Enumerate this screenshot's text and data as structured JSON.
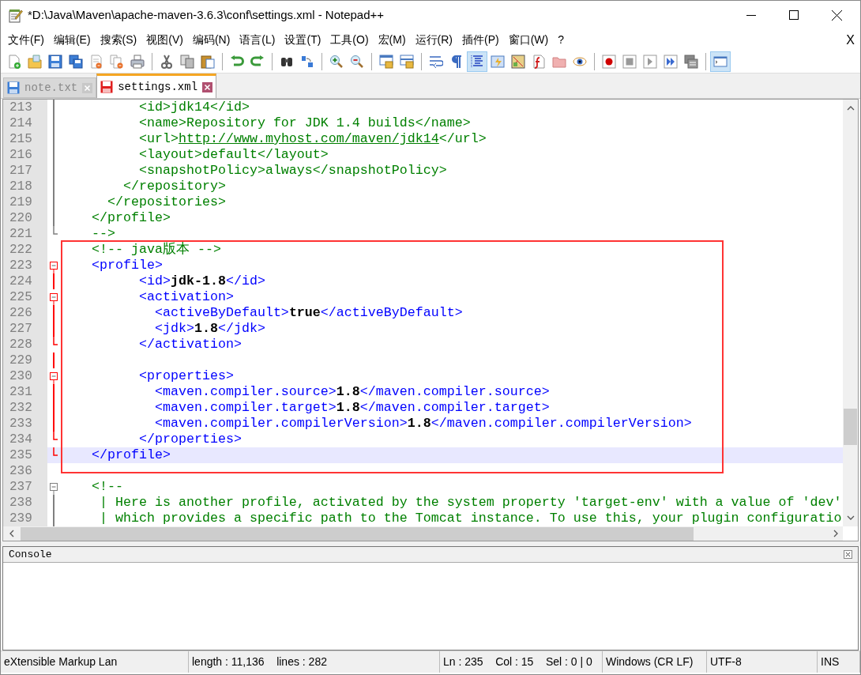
{
  "window": {
    "title": "*D:\\Java\\Maven\\apache-maven-3.6.3\\conf\\settings.xml - Notepad++"
  },
  "menu": [
    "文件(F)",
    "编辑(E)",
    "搜索(S)",
    "视图(V)",
    "编码(N)",
    "语言(L)",
    "设置(T)",
    "工具(O)",
    "宏(M)",
    "运行(R)",
    "插件(P)",
    "窗口(W)",
    "?"
  ],
  "menu_close": "X",
  "toolbar": [
    {
      "kind": "new",
      "pressed": false
    },
    {
      "kind": "open",
      "pressed": false
    },
    {
      "kind": "save",
      "pressed": false
    },
    {
      "kind": "save-all",
      "pressed": false
    },
    {
      "kind": "close",
      "pressed": false
    },
    {
      "kind": "close-all",
      "pressed": false
    },
    {
      "kind": "print",
      "pressed": false
    },
    {
      "kind": "separator"
    },
    {
      "kind": "cut",
      "pressed": false
    },
    {
      "kind": "copy",
      "pressed": false
    },
    {
      "kind": "paste",
      "pressed": false
    },
    {
      "kind": "separator"
    },
    {
      "kind": "undo",
      "pressed": false
    },
    {
      "kind": "redo",
      "pressed": false
    },
    {
      "kind": "separator"
    },
    {
      "kind": "find",
      "pressed": false
    },
    {
      "kind": "replace",
      "pressed": false
    },
    {
      "kind": "separator"
    },
    {
      "kind": "zoom-in",
      "pressed": false
    },
    {
      "kind": "zoom-out",
      "pressed": false
    },
    {
      "kind": "separator"
    },
    {
      "kind": "sync-v",
      "pressed": false
    },
    {
      "kind": "sync-h",
      "pressed": false
    },
    {
      "kind": "separator"
    },
    {
      "kind": "wrap",
      "pressed": false
    },
    {
      "kind": "all-chars",
      "pressed": false
    },
    {
      "kind": "indent-guide",
      "pressed": true
    },
    {
      "kind": "udl",
      "pressed": false
    },
    {
      "kind": "doc-map",
      "pressed": false
    },
    {
      "kind": "func-list",
      "pressed": false
    },
    {
      "kind": "folder",
      "pressed": false
    },
    {
      "kind": "monitor",
      "pressed": false
    },
    {
      "kind": "separator"
    },
    {
      "kind": "record",
      "pressed": false
    },
    {
      "kind": "stop",
      "pressed": false
    },
    {
      "kind": "play",
      "pressed": false
    },
    {
      "kind": "play-multi",
      "pressed": false
    },
    {
      "kind": "save-macro",
      "pressed": false
    },
    {
      "kind": "separator"
    },
    {
      "kind": "console",
      "pressed": true
    }
  ],
  "tabs": [
    {
      "label": "note.txt",
      "selected": false,
      "modified": false
    },
    {
      "label": "settings.xml",
      "selected": true,
      "modified": true
    }
  ],
  "editor": {
    "lines": [
      {
        "number": "213",
        "current": false,
        "fold_marker": {
          "kind": "body",
          "active": false
        },
        "segments": [
          {
            "kind": "comment",
            "text": "          <id>jdk14</id>"
          }
        ]
      },
      {
        "number": "214",
        "current": false,
        "fold_marker": {
          "kind": "body",
          "active": false
        },
        "segments": [
          {
            "kind": "comment",
            "text": "          <name>Repository for JDK 1.4 builds</name>"
          }
        ]
      },
      {
        "number": "215",
        "current": false,
        "fold_marker": {
          "kind": "body",
          "active": false
        },
        "segments": [
          {
            "kind": "comment",
            "text": "          <url>"
          },
          {
            "kind": "link",
            "text": "http://www.myhost.com/maven/jdk14"
          },
          {
            "kind": "comment",
            "text": "</url>"
          }
        ]
      },
      {
        "number": "216",
        "current": false,
        "fold_marker": {
          "kind": "body",
          "active": false
        },
        "segments": [
          {
            "kind": "comment",
            "text": "          <layout>default</layout>"
          }
        ]
      },
      {
        "number": "217",
        "current": false,
        "fold_marker": {
          "kind": "body",
          "active": false
        },
        "segments": [
          {
            "kind": "comment",
            "text": "          <snapshotPolicy>always</snapshotPolicy>"
          }
        ]
      },
      {
        "number": "218",
        "current": false,
        "fold_marker": {
          "kind": "body",
          "active": false
        },
        "segments": [
          {
            "kind": "comment",
            "text": "        </repository>"
          }
        ]
      },
      {
        "number": "219",
        "current": false,
        "fold_marker": {
          "kind": "body",
          "active": false
        },
        "segments": [
          {
            "kind": "comment",
            "text": "      </repositories>"
          }
        ]
      },
      {
        "number": "220",
        "current": false,
        "fold_marker": {
          "kind": "body",
          "active": false
        },
        "segments": [
          {
            "kind": "comment",
            "text": "    </profile>"
          }
        ]
      },
      {
        "number": "221",
        "current": false,
        "fold_marker": {
          "kind": "end",
          "active": false
        },
        "segments": [
          {
            "kind": "comment",
            "text": "    -->"
          }
        ]
      },
      {
        "number": "222",
        "current": false,
        "segments": [
          {
            "kind": "comment",
            "text": "    <!-- java版本 -->"
          }
        ]
      },
      {
        "number": "223",
        "current": false,
        "fold_marker": {
          "kind": "open",
          "active": true
        },
        "segments": [
          {
            "kind": "tag",
            "text": "    <profile>"
          }
        ]
      },
      {
        "number": "224",
        "current": false,
        "fold_marker": {
          "kind": "body",
          "active": true
        },
        "segments": [
          {
            "kind": "tag",
            "text": "          <id>"
          },
          {
            "kind": "value",
            "text": "jdk-1.8"
          },
          {
            "kind": "tag",
            "text": "</id>"
          }
        ]
      },
      {
        "number": "225",
        "current": false,
        "fold_marker": {
          "kind": "open",
          "active": true
        },
        "segments": [
          {
            "kind": "tag",
            "text": "          <activation>"
          }
        ]
      },
      {
        "number": "226",
        "current": false,
        "fold_marker": {
          "kind": "body",
          "active": true
        },
        "segments": [
          {
            "kind": "tag",
            "text": "            <activeByDefault>"
          },
          {
            "kind": "value",
            "text": "true"
          },
          {
            "kind": "tag",
            "text": "</activeByDefault>"
          }
        ]
      },
      {
        "number": "227",
        "current": false,
        "fold_marker": {
          "kind": "body",
          "active": true
        },
        "segments": [
          {
            "kind": "tag",
            "text": "            <jdk>"
          },
          {
            "kind": "value",
            "text": "1.8"
          },
          {
            "kind": "tag",
            "text": "</jdk>"
          }
        ]
      },
      {
        "number": "228",
        "current": false,
        "fold_marker": {
          "kind": "end",
          "active": true
        },
        "segments": [
          {
            "kind": "tag",
            "text": "          </activation>"
          }
        ]
      },
      {
        "number": "229",
        "current": false,
        "fold_marker": {
          "kind": "body",
          "active": true
        }
      },
      {
        "number": "230",
        "current": false,
        "fold_marker": {
          "kind": "open",
          "active": true
        },
        "segments": [
          {
            "kind": "tag",
            "text": "          <properties>"
          }
        ]
      },
      {
        "number": "231",
        "current": false,
        "fold_marker": {
          "kind": "body",
          "active": true
        },
        "segments": [
          {
            "kind": "tag",
            "text": "            <maven.compiler.source>"
          },
          {
            "kind": "value",
            "text": "1.8"
          },
          {
            "kind": "tag",
            "text": "</maven.compiler.source>"
          }
        ]
      },
      {
        "number": "232",
        "current": false,
        "fold_marker": {
          "kind": "body",
          "active": true
        },
        "segments": [
          {
            "kind": "tag",
            "text": "            <maven.compiler.target>"
          },
          {
            "kind": "value",
            "text": "1.8"
          },
          {
            "kind": "tag",
            "text": "</maven.compiler.target>"
          }
        ]
      },
      {
        "number": "233",
        "current": false,
        "fold_marker": {
          "kind": "body",
          "active": true
        },
        "segments": [
          {
            "kind": "tag",
            "text": "            <maven.compiler.compilerVersion>"
          },
          {
            "kind": "value",
            "text": "1.8"
          },
          {
            "kind": "tag",
            "text": "</maven.compiler.compilerVersion>"
          }
        ]
      },
      {
        "number": "234",
        "current": false,
        "fold_marker": {
          "kind": "end",
          "active": true
        },
        "segments": [
          {
            "kind": "tag",
            "text": "          </properties>"
          }
        ]
      },
      {
        "number": "235",
        "current": true,
        "fold_marker": {
          "kind": "end",
          "active": true
        },
        "segments": [
          {
            "kind": "tag",
            "text": "    </profile>"
          }
        ]
      },
      {
        "number": "236",
        "current": false
      },
      {
        "number": "237",
        "current": false,
        "fold_marker": {
          "kind": "open",
          "active": false
        },
        "segments": [
          {
            "kind": "comment",
            "text": "    <!--"
          }
        ]
      },
      {
        "number": "238",
        "current": false,
        "fold_marker": {
          "kind": "body",
          "active": false
        },
        "segments": [
          {
            "kind": "comment",
            "text": "     | Here is another profile, activated by the system property 'target-env' with a value of 'dev'"
          }
        ]
      },
      {
        "number": "239",
        "current": false,
        "fold_marker": {
          "kind": "body",
          "active": false
        },
        "segments": [
          {
            "kind": "comment",
            "text": "     | which provides a specific path to the Tomcat instance. To use this, your plugin configuratio"
          }
        ]
      }
    ]
  },
  "console": {
    "title": "Console"
  },
  "status_bar": [
    "eXtensible Markup Lan",
    "length : 11,136    lines : 282",
    "Ln : 235    Col : 15    Sel : 0 | 0",
    "Windows (CR LF)",
    "UTF-8",
    "INS"
  ]
}
